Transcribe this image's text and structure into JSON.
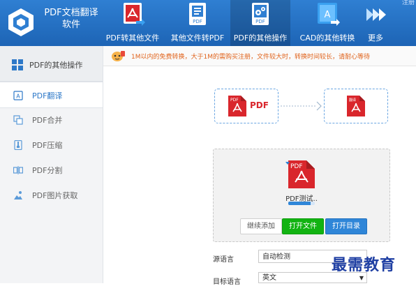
{
  "app": {
    "title_line1": "PDF文档翻译",
    "title_line2": "软件",
    "corner_text": "注册"
  },
  "toolbar": {
    "items": [
      {
        "label": "PDF转其他文件",
        "icon": "pdf-convert-icon"
      },
      {
        "label": "其他文件转PDF",
        "icon": "file-to-pdf-icon"
      },
      {
        "label": "PDF的其他操作",
        "icon": "pdf-gears-icon"
      },
      {
        "label": "CAD的其他转换",
        "icon": "cad-convert-icon"
      },
      {
        "label": "更多",
        "icon": "more-arrows-icon"
      }
    ],
    "active_index": 2
  },
  "sidebar": {
    "header": "PDF的其他操作",
    "items": [
      {
        "label": "PDF翻译",
        "icon": "translate-icon"
      },
      {
        "label": "PDF合并",
        "icon": "merge-icon"
      },
      {
        "label": "PDF压缩",
        "icon": "compress-icon"
      },
      {
        "label": "PDF分割",
        "icon": "split-icon"
      },
      {
        "label": "PDF图片获取",
        "icon": "image-extract-icon"
      }
    ],
    "active_index": 0
  },
  "notice": {
    "text": "1M以内的免费转换，大于1M的需购买注册，文件较大时，转换时间较长，请耐心等待"
  },
  "flow": {
    "source_label": "PDF",
    "source_badge": "PDF",
    "target_badge": "翻译"
  },
  "file_panel": {
    "file_badge": "PDF",
    "file_name": "PDF测试..",
    "progress": 0.85,
    "add_button": "继续添加",
    "open_file_button": "打开文件",
    "open_folder_button": "打开目录"
  },
  "form": {
    "source_language_label": "源语言",
    "source_language_value": "自动检测",
    "target_language_label": "目标语言",
    "target_language_value": "英文"
  },
  "watermark": "最需教育",
  "colors": {
    "topbar": "#2f7fd2",
    "accent": "#2d78c8",
    "pdf_red": "#d9262c",
    "green_button": "#12b312",
    "blue_button": "#2f86d8",
    "notice_text": "#e0631c"
  }
}
